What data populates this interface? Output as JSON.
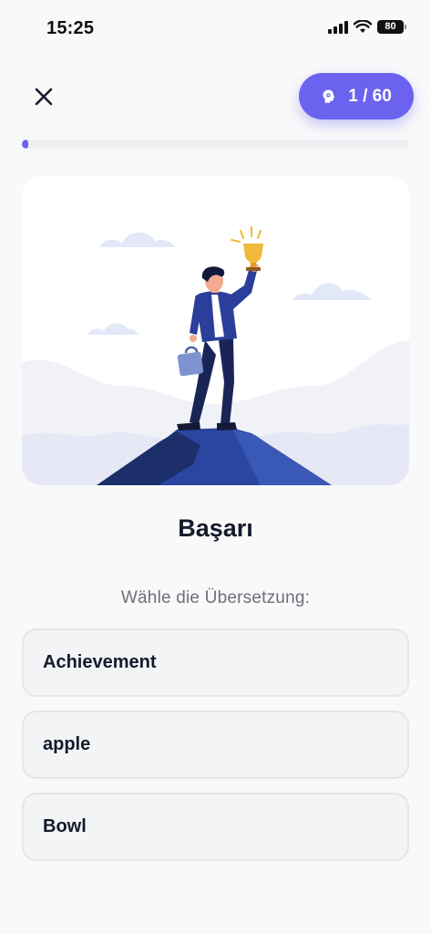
{
  "status_bar": {
    "time": "15:25",
    "battery": "80"
  },
  "header": {
    "counter": "1 / 60",
    "counter_icon": "brain-icon",
    "close_icon": "close-icon"
  },
  "progress": {
    "current": 1,
    "total": 60
  },
  "illustration": {
    "subject": "person-holding-trophy-on-mountain"
  },
  "quiz": {
    "word": "Başarı",
    "instruction": "Wähle die Übersetzung:",
    "options": [
      "Achievement",
      "apple",
      "Bowl"
    ]
  },
  "colors": {
    "accent": "#6b63ef",
    "background": "#f9f9fa",
    "text": "#151a2c",
    "muted": "#6b6f7b"
  }
}
